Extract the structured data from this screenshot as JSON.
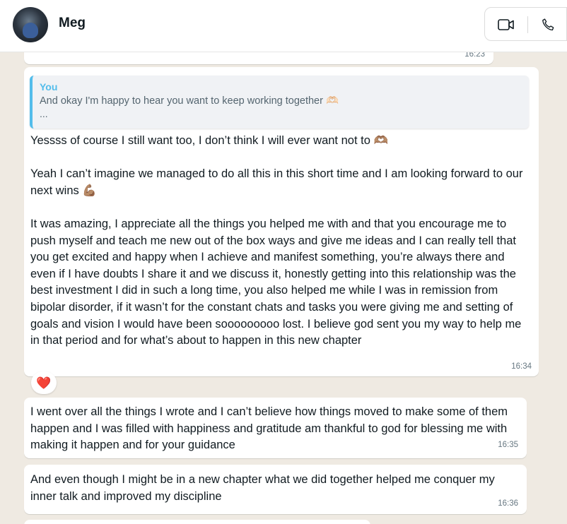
{
  "header": {
    "contact_name": "Meg",
    "icons": {
      "avatar": "avatar",
      "video": "video-call-icon",
      "phone": "phone-call-icon"
    }
  },
  "messages": [
    {
      "id": "m0",
      "text": "",
      "time": "16:23"
    },
    {
      "id": "m1",
      "quote": {
        "author": "You",
        "text": "And okay I'm happy to hear you want to keep working together 🫶🏻",
        "more": "..."
      },
      "paragraphs": [
        "Yessss of course I still want too, I don’t think I will ever want not to 🫶🏽",
        "Yeah I can’t imagine we managed to do all this in this short time and I am looking forward to our next wins 💪🏽",
        "It was amazing, I appreciate all the things you helped me with and that you encourage me to push myself and teach me new out of the box ways and give me ideas and I can really tell that you get excited and happy when I achieve and manifest something, you’re always there and even if I have doubts I share it and we discuss it, honestly getting into this relationship was the best investment I did in such a long time, you also helped me while I was in remission from bipolar disorder, if it wasn’t for the constant chats and tasks you were giving me and setting of goals and vision I would have been sooooooooo lost. I believe god sent you my way to help me in that period and for what’s about to happen in this new chapter"
      ],
      "time": "16:34",
      "reaction": "❤️"
    },
    {
      "id": "m2",
      "text": "I went over all the things I wrote and I can’t believe how things moved to make some of them happen and I was filled with happiness and gratitude am thankful to god for blessing me with making it happen and for your guidance",
      "time": "16:35"
    },
    {
      "id": "m3",
      "text": "And even though I might be in a new chapter what we did together helped me conquer my inner talk and improved my discipline",
      "time": "16:36"
    }
  ],
  "colors": {
    "chat_background": "#efeae2",
    "bubble": "#ffffff",
    "quote_accent": "#53bdeb",
    "timestamp": "#667781",
    "reaction_heart": "#e0245e"
  }
}
